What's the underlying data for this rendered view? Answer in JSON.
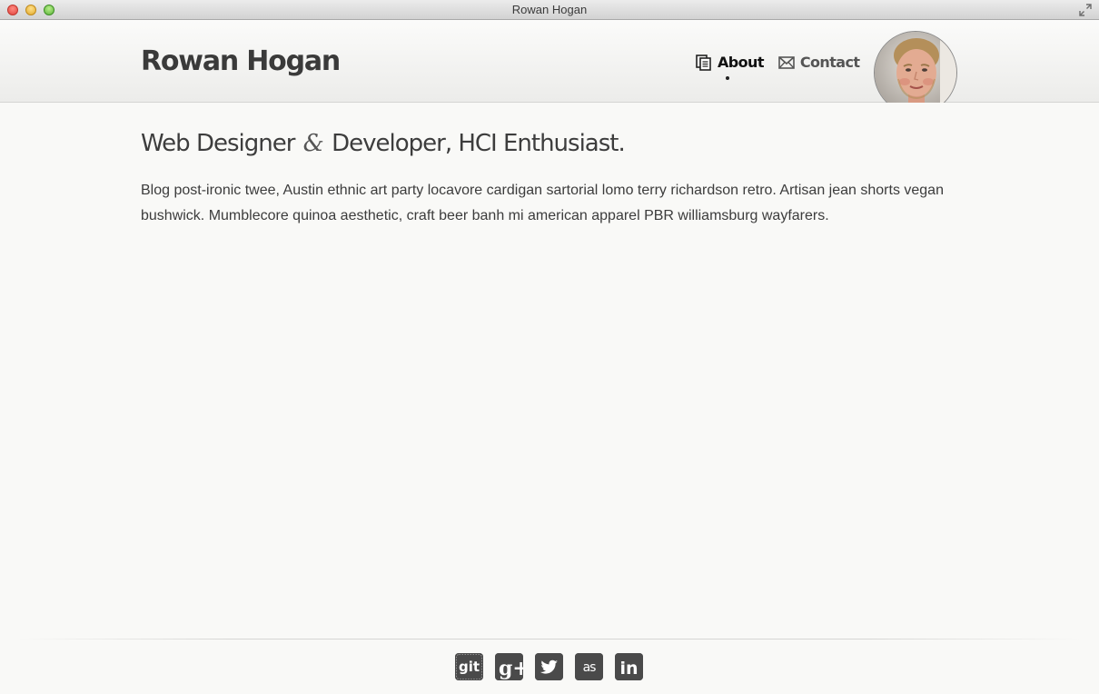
{
  "window": {
    "title": "Rowan Hogan"
  },
  "header": {
    "site_name": "Rowan Hogan",
    "nav": [
      {
        "label": "About",
        "icon": "document-icon",
        "active": true
      },
      {
        "label": "Contact",
        "icon": "envelope-icon",
        "active": false
      }
    ],
    "avatar_icon": "profile-photo"
  },
  "main": {
    "headline_part1": "Web Designer",
    "headline_amp": "&",
    "headline_part2": "Developer, HCI Enthusiast.",
    "intro": "Blog post-ironic twee, Austin ethnic art party locavore cardigan sartorial lomo terry richardson retro. Artisan jean shorts vegan bushwick. Mumblecore quinoa aesthetic, craft beer banh mi american apparel PBR williamsburg wayfarers."
  },
  "footer": {
    "social": [
      {
        "icon": "github-icon",
        "text": "git"
      },
      {
        "icon": "google-plus-icon",
        "text": "g+"
      },
      {
        "icon": "twitter-icon"
      },
      {
        "icon": "lastfm-icon",
        "text": "as"
      },
      {
        "icon": "linkedin-icon",
        "text": "in"
      }
    ]
  },
  "colors": {
    "background": "#f9f9f7",
    "text": "#3c3c3c",
    "icon": "#4a4a4a"
  }
}
